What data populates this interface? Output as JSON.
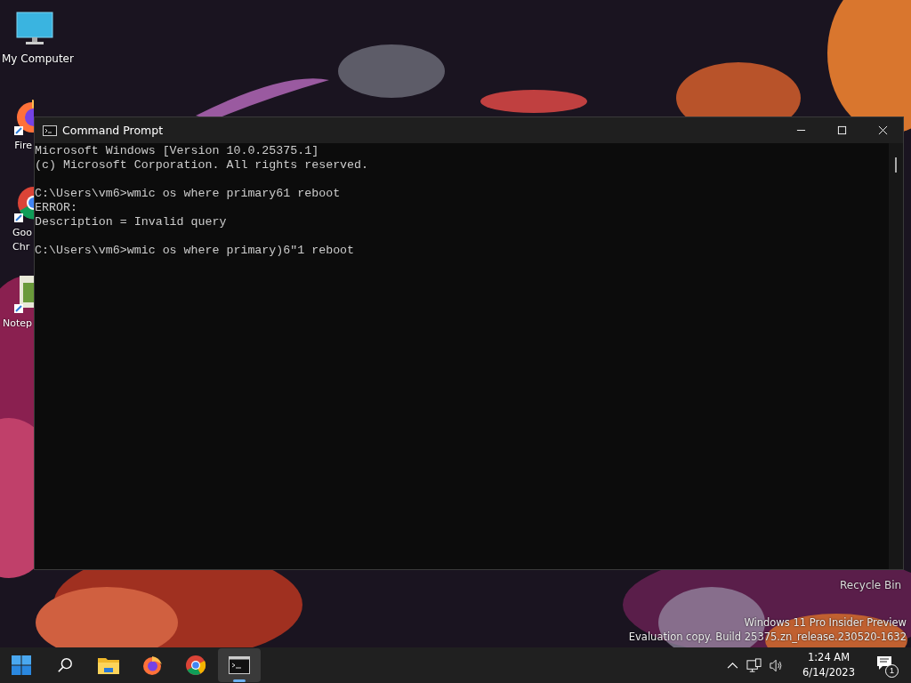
{
  "desktop": {
    "icons": [
      {
        "kind": "computer",
        "label": "My Computer"
      },
      {
        "kind": "firefox",
        "label": "Fire"
      },
      {
        "kind": "chrome",
        "label": "Goo\nChr"
      },
      {
        "kind": "notepad",
        "label": "Notep"
      }
    ],
    "recycle_bin": "Recycle Bin",
    "edition": [
      "Windows 11 Pro Insider Preview",
      "Evaluation copy. Build 25375.zn_release.230520-1632"
    ]
  },
  "window": {
    "title": "Command Prompt",
    "blocks": [
      [
        "Microsoft Windows [Version 10.0.25375.1]",
        "(c) Microsoft Corporation. All rights reserved."
      ],
      [
        "C:\\Users\\vm6>wmic os where primary61 reboot",
        "ERROR:",
        "Description = Invalid query"
      ],
      [
        "C:\\Users\\vm6>wmic os where primary)6\"1 reboot"
      ]
    ]
  },
  "taskbar": {
    "apps": [
      {
        "kind": "start",
        "selected": false
      },
      {
        "kind": "search",
        "selected": false
      },
      {
        "kind": "explorer",
        "selected": false
      },
      {
        "kind": "firefox",
        "selected": false
      },
      {
        "kind": "chrome",
        "selected": false
      },
      {
        "kind": "terminal",
        "selected": true
      }
    ],
    "time": "1:24 AM",
    "date": "6/14/2023",
    "notifications": "1"
  }
}
